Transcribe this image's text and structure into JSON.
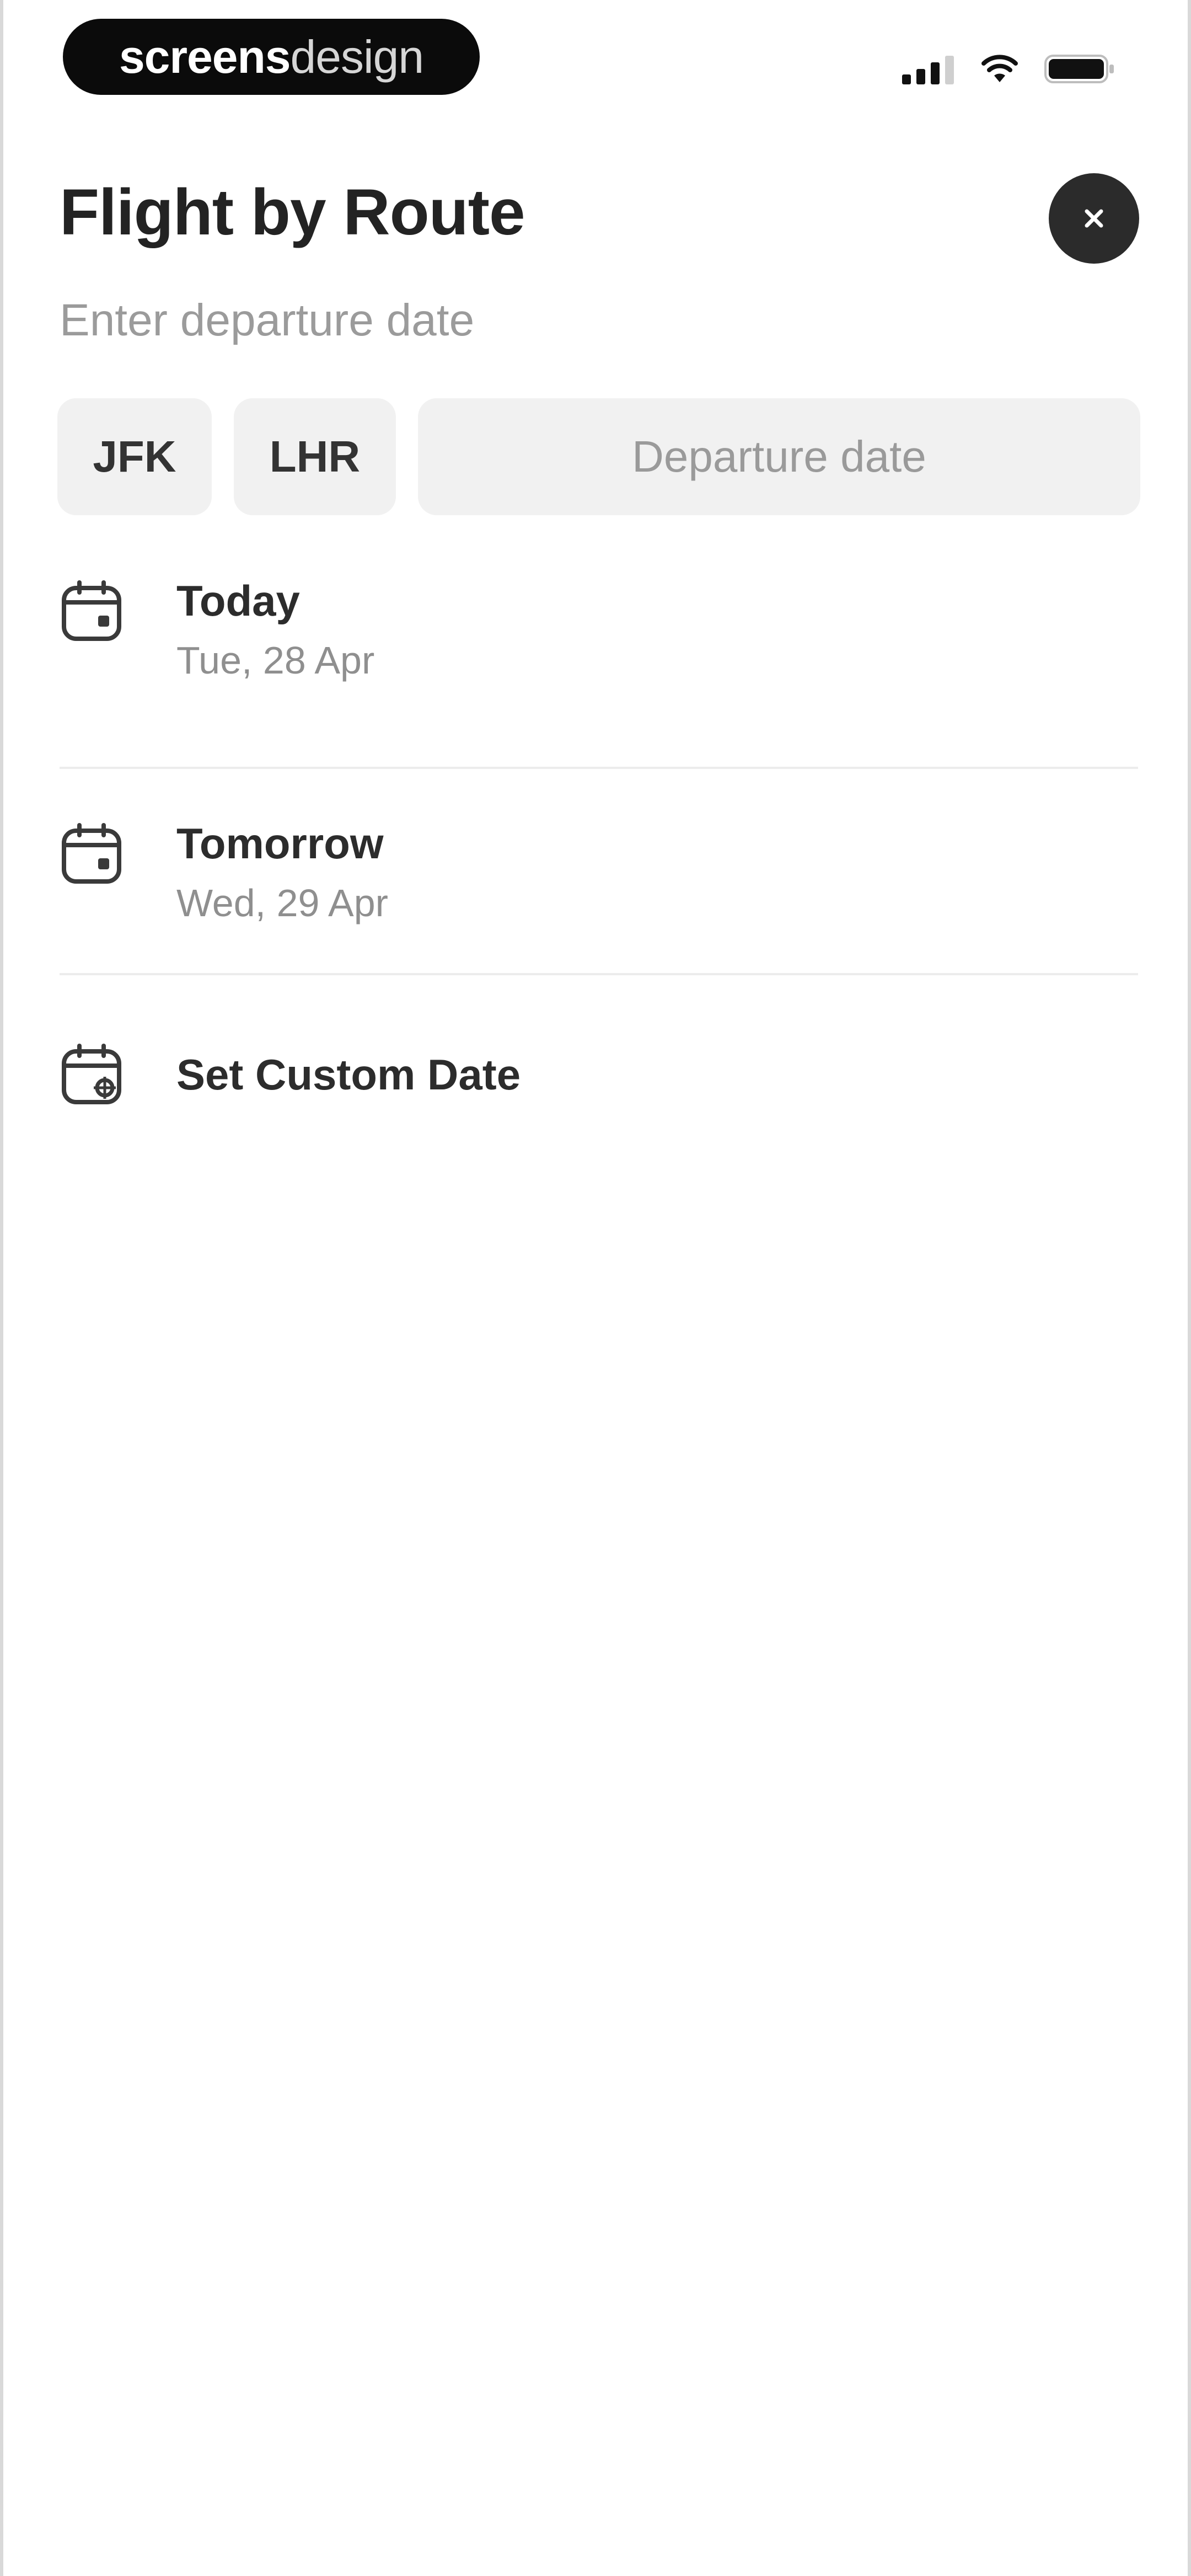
{
  "status_bar": {
    "brand_part1": "screens",
    "brand_part2": "design"
  },
  "header": {
    "title": "Flight by Route",
    "subtitle": "Enter departure date"
  },
  "route": {
    "origin": "JFK",
    "destination": "LHR",
    "date_placeholder": "Departure date"
  },
  "date_options": [
    {
      "label": "Today",
      "sub": "Tue, 28 Apr",
      "icon": "calendar-icon"
    },
    {
      "label": "Tomorrow",
      "sub": "Wed, 29 Apr",
      "icon": "calendar-icon"
    },
    {
      "label": "Set Custom Date",
      "icon": "calendar-custom-icon"
    }
  ]
}
